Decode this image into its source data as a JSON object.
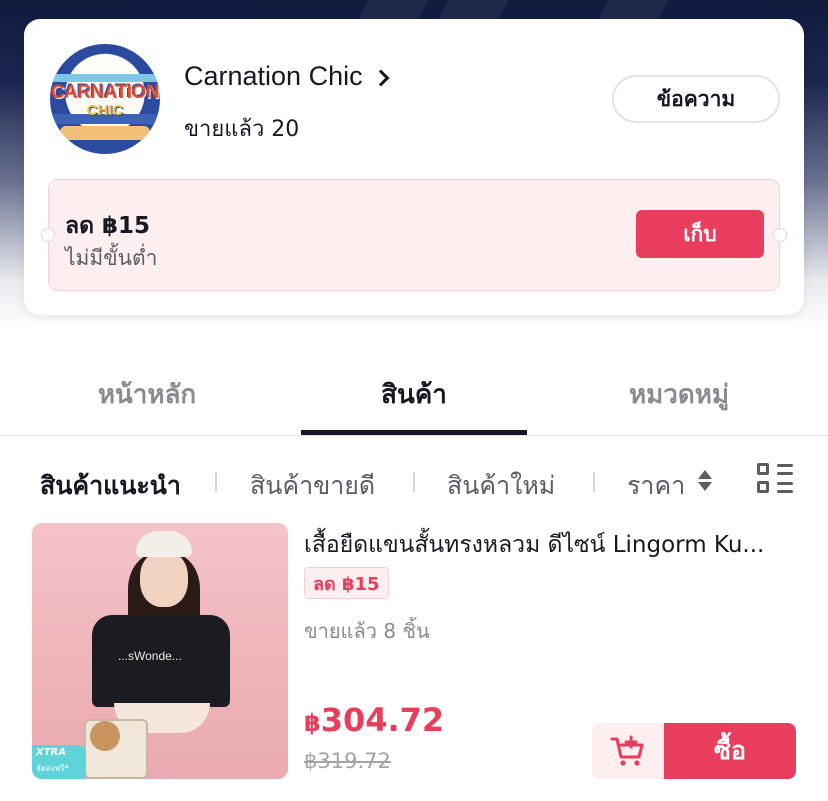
{
  "shop": {
    "avatar_logo_line1": "CARNATION",
    "avatar_logo_line2": "CHIC",
    "name": "Carnation Chic",
    "sold_total": "ขายแล้ว 20",
    "message_label": "ข้อความ"
  },
  "voucher": {
    "title": "ลด ฿15",
    "subtitle": "ไม่มีขั้นต่ำ",
    "collect_label": "เก็บ"
  },
  "tabs": [
    {
      "label": "หน้าหลัก",
      "active": false
    },
    {
      "label": "สินค้า",
      "active": true
    },
    {
      "label": "หมวดหมู่",
      "active": false
    }
  ],
  "subnav": {
    "recommended": "สินค้าแนะนำ",
    "best_selling": "สินค้าขายดี",
    "new": "สินค้าใหม่",
    "price": "ราคา"
  },
  "product": {
    "title": "เสื้อยืดแขนสั้นทรงหลวม ดีไซน์ Lingorm Ku...",
    "discount_badge": "ลด ฿15",
    "sold": "ขายแล้ว 8 ชิ้น",
    "currency": "฿",
    "price": "304.72",
    "original_price": "฿319.72",
    "buy_label": "ซื้อ",
    "badge_xtra": "XTRA",
    "badge_xtra_sub": "จัดส่งฟรี*",
    "shirt_print": "...sWonde..."
  },
  "colors": {
    "accent": "#e83d5c",
    "accent_light": "#fdeef0",
    "text": "#161823",
    "muted": "#8a8b91"
  },
  "icons": [
    "chevron-right-icon",
    "sort-icon",
    "grid-list-icon",
    "add-to-cart-icon"
  ]
}
